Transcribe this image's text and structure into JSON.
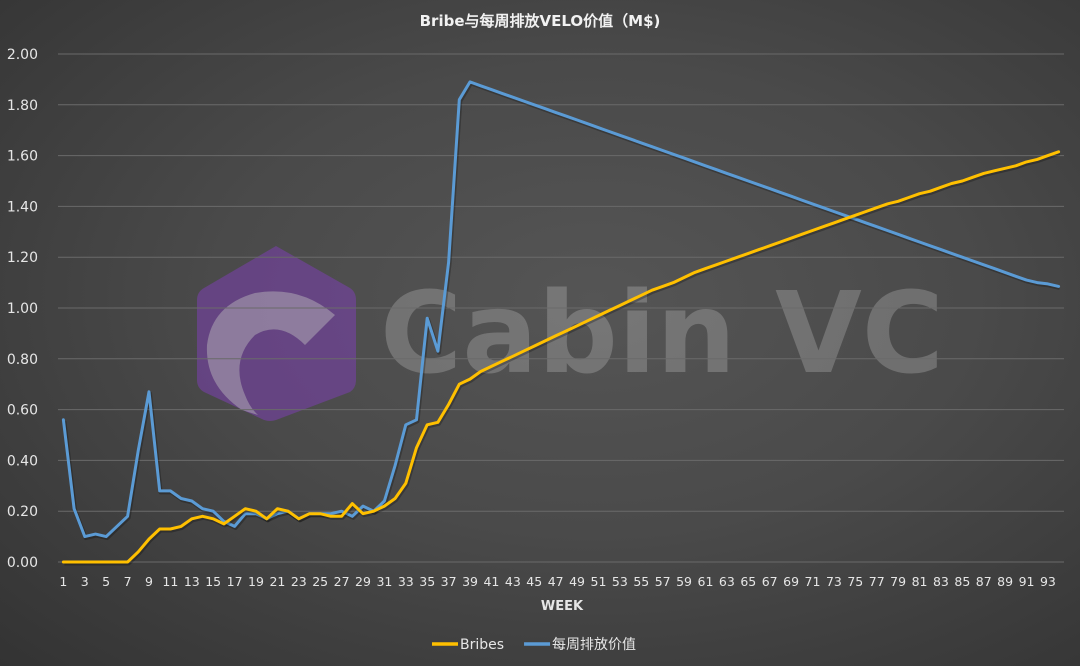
{
  "chart_data": {
    "type": "line",
    "title": "Bribe与每周排放VELO价值（M$)",
    "xlabel": "WEEK",
    "ylabel": "",
    "ylim": [
      0,
      2.0
    ],
    "yticks": [
      "0.00",
      "0.20",
      "0.40",
      "0.60",
      "0.80",
      "1.00",
      "1.20",
      "1.40",
      "1.60",
      "1.80",
      "2.00"
    ],
    "ytick_values": [
      0,
      0.2,
      0.4,
      0.6,
      0.8,
      1.0,
      1.2,
      1.4,
      1.6,
      1.8,
      2.0
    ],
    "x_count": 94,
    "x_label_every": 2,
    "grid": true,
    "legend_position": "bottom",
    "series": [
      {
        "name": "Bribes",
        "color": "#FFC000",
        "values": [
          0,
          0,
          0,
          0,
          0,
          0,
          0,
          0.04,
          0.09,
          0.13,
          0.13,
          0.14,
          0.17,
          0.18,
          0.17,
          0.15,
          0.18,
          0.21,
          0.2,
          0.17,
          0.21,
          0.2,
          0.17,
          0.19,
          0.19,
          0.18,
          0.18,
          0.23,
          0.19,
          0.2,
          0.22,
          0.25,
          0.31,
          0.45,
          0.54,
          0.55,
          0.62,
          0.7,
          0.72,
          0.75,
          0.77,
          0.79,
          0.81,
          0.83,
          0.85,
          0.87,
          0.89,
          0.91,
          0.93,
          0.95,
          0.97,
          0.99,
          1.01,
          1.03,
          1.05,
          1.07,
          1.085,
          1.1,
          1.12,
          1.14,
          1.155,
          1.17,
          1.185,
          1.2,
          1.215,
          1.23,
          1.245,
          1.26,
          1.275,
          1.29,
          1.305,
          1.32,
          1.335,
          1.35,
          1.365,
          1.38,
          1.395,
          1.41,
          1.42,
          1.435,
          1.45,
          1.46,
          1.475,
          1.49,
          1.5,
          1.515,
          1.53,
          1.54,
          1.55,
          1.56,
          1.575,
          1.585,
          1.6,
          1.615
        ]
      },
      {
        "name": "每周排放价值",
        "color": "#5B9BD5",
        "values": [
          0.56,
          0.21,
          0.1,
          0.11,
          0.1,
          0.14,
          0.18,
          0.44,
          0.67,
          0.28,
          0.28,
          0.25,
          0.24,
          0.21,
          0.2,
          0.16,
          0.14,
          0.19,
          0.19,
          0.17,
          0.19,
          0.2,
          0.17,
          0.19,
          0.19,
          0.19,
          0.2,
          0.18,
          0.22,
          0.2,
          0.24,
          0.38,
          0.54,
          0.56,
          0.96,
          0.83,
          1.18,
          1.82,
          1.89,
          1.875,
          1.86,
          1.845,
          1.83,
          1.815,
          1.8,
          1.785,
          1.77,
          1.755,
          1.74,
          1.725,
          1.71,
          1.695,
          1.68,
          1.665,
          1.65,
          1.635,
          1.62,
          1.605,
          1.59,
          1.575,
          1.56,
          1.545,
          1.53,
          1.515,
          1.5,
          1.485,
          1.47,
          1.455,
          1.44,
          1.425,
          1.41,
          1.395,
          1.38,
          1.365,
          1.35,
          1.335,
          1.32,
          1.305,
          1.29,
          1.275,
          1.26,
          1.245,
          1.23,
          1.215,
          1.2,
          1.185,
          1.17,
          1.155,
          1.14,
          1.125,
          1.11,
          1.1,
          1.095,
          1.085
        ]
      }
    ],
    "watermark": "Cabin VC"
  }
}
